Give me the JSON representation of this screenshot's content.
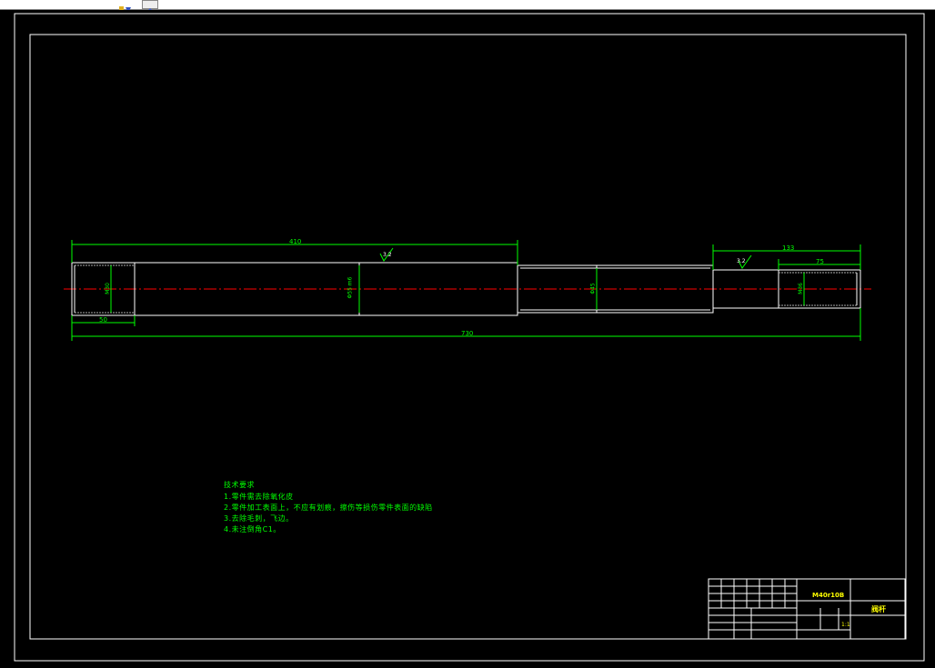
{
  "toolbar": {
    "icons": [
      "layer-tool-icon",
      "layer-state-icon"
    ]
  },
  "drawing": {
    "dimensions": {
      "total_length": "730",
      "left_section_length": "410",
      "right_section_length": "133",
      "right_thread_length": "75",
      "left_thread_length": "50",
      "left_thread_diameter": "M30",
      "main_diameter": "Φ55 m6",
      "middle_diameter": "Φ45",
      "right_thread_diameter": "M36"
    },
    "surface_roughness": [
      "3.2",
      "3.2"
    ],
    "technical_requirements": {
      "title": "技术要求",
      "items": [
        "1.零件需去除氧化皮",
        "2.零件加工表面上，不应有划痕，擦伤等损伤零件表面的缺陷",
        "3.去除毛刺，飞边。",
        "4.未注倒角C1。"
      ]
    },
    "title_block": {
      "material": "M40r10B",
      "part_name": "阀杆",
      "scale": "1:1"
    },
    "colors": {
      "background": "#000000",
      "dimension_lines": "#00ff00",
      "geometry": "#ffffff",
      "centerline": "#ff0000",
      "title_block_text": "#ffff00"
    }
  }
}
